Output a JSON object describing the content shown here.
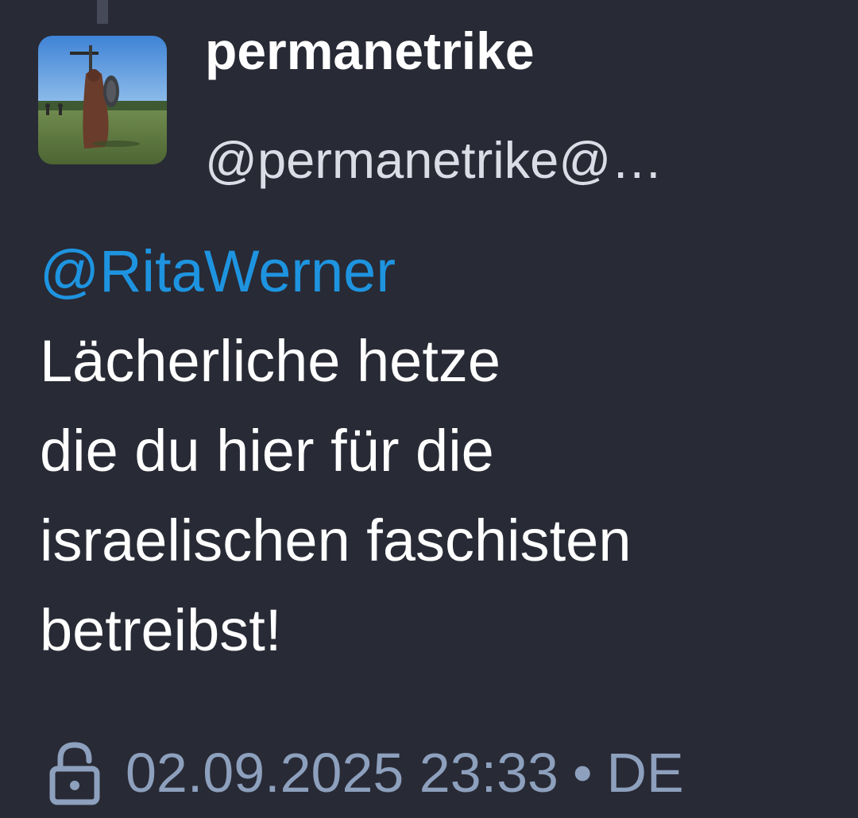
{
  "colors": {
    "background": "#282a35",
    "mention": "#1e94e0",
    "meta": "#8da0bd",
    "text": "#ffffff"
  },
  "post": {
    "display_name": "permanetrike",
    "handle": "@permanetrike@…",
    "mention": "@RitaWerner",
    "body_lines": [
      "Lächerliche hetze",
      "die du hier für die",
      "israelischen faschisten",
      "betreibst!"
    ],
    "visibility_icon": "lock-open-icon",
    "timestamp": "02.09.2025 23:33",
    "separator": "•",
    "language": "DE"
  }
}
